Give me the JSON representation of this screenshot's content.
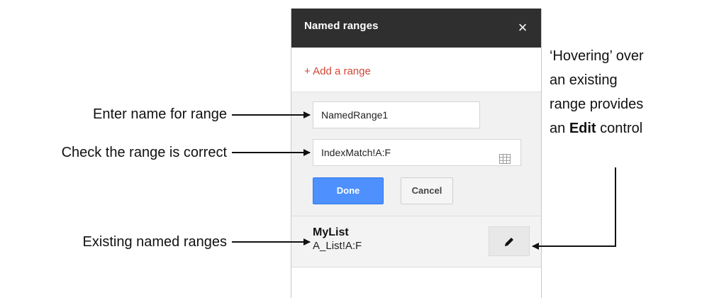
{
  "panel": {
    "title": "Named ranges",
    "close_icon": "×",
    "add_range_label": "+ Add a range",
    "name_field_value": "NamedRange1",
    "range_field_value": "IndexMatch!A:F",
    "done_label": "Done",
    "cancel_label": "Cancel",
    "existing_ranges": [
      {
        "name": "MyList",
        "range": "A_List!A:F"
      }
    ]
  },
  "annotations": {
    "enter_name": "Enter name for range",
    "check_range": "Check the range is correct",
    "existing": "Existing named ranges",
    "hover_note_line1": "‘Hovering’ over",
    "hover_note_line2": "an existing",
    "hover_note_line3": "range provides",
    "hover_note_line4_prefix": "an ",
    "hover_note_line4_bold": "Edit",
    "hover_note_line4_suffix": " control"
  },
  "colors": {
    "header_bg": "#2f2f2f",
    "add_link": "#d14836",
    "done_button": "#4d90fe"
  },
  "icons": [
    "close-icon",
    "grid-icon",
    "pencil-icon"
  ]
}
